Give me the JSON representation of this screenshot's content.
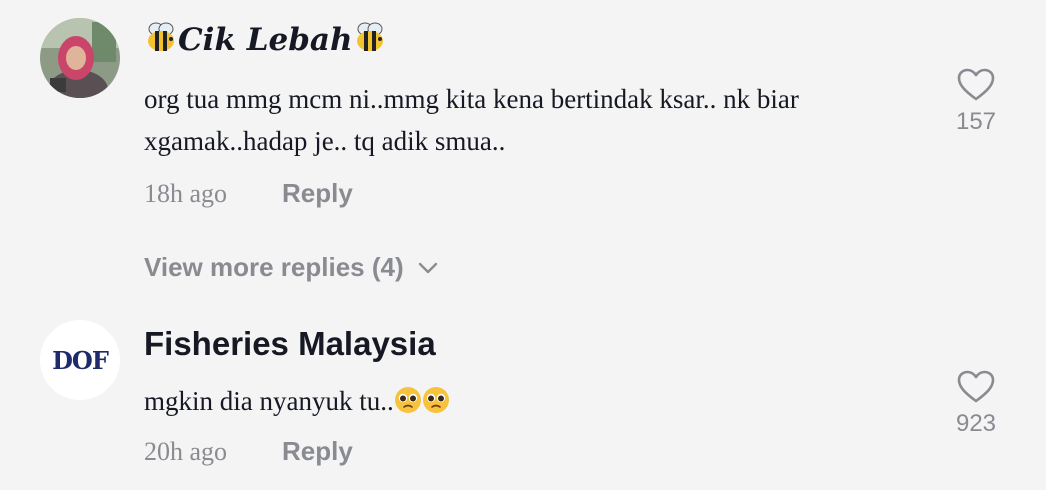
{
  "comments": [
    {
      "username": "Cik Lebah",
      "username_decoration": "bee-icon",
      "text": "org tua mmg mcm ni..mmg kita kena bertindak ksar.. nk biar xgamak..hadap je.. tq adik smua..",
      "time": "18h ago",
      "reply_label": "Reply",
      "like_count": "157"
    },
    {
      "username": "Fisheries Malaysia",
      "avatar_text": "DOF",
      "text": "mgkin dia nyanyuk tu..",
      "text_emoji": "pleading-face-emoji",
      "time": "20h ago",
      "reply_label": "Reply",
      "like_count": "923"
    }
  ],
  "view_more_replies": "View more replies (4)",
  "colors": {
    "background": "#f4f4f5",
    "primary_text": "#161823",
    "secondary_text": "#8a8b91",
    "dof_blue": "#1f2a6b"
  }
}
